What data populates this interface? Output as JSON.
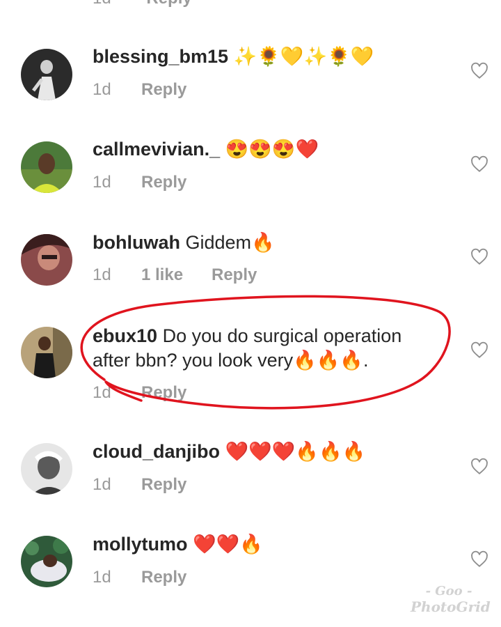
{
  "partial_top": {
    "time": "1d",
    "reply": "Reply"
  },
  "comments": [
    {
      "username": "blessing_bm15",
      "message": "✨🌻💛✨🌻💛",
      "time": "1d",
      "likes": "",
      "reply": "Reply"
    },
    {
      "username": "callmevivian._",
      "message": "😍😍😍❤️",
      "time": "1d",
      "likes": "",
      "reply": "Reply"
    },
    {
      "username": "bohluwah",
      "message": "Giddem🔥",
      "time": "1d",
      "likes": "1 like",
      "reply": "Reply"
    },
    {
      "username": "ebux10",
      "message": "Do you do surgical operation after bbn? you look very🔥🔥🔥.",
      "time": "1d",
      "likes": "",
      "reply": "Reply"
    },
    {
      "username": "cloud_danjibo",
      "message": "❤️❤️❤️🔥🔥🔥",
      "time": "1d",
      "likes": "",
      "reply": "Reply"
    },
    {
      "username": "mollytumo",
      "message": "❤️❤️🔥",
      "time": "1d",
      "likes": "",
      "reply": "Reply"
    }
  ],
  "annotation_color": "#e0141e",
  "watermark": {
    "line1": "- Goo -",
    "line2": "PhotoGrid"
  },
  "icons": {
    "like": "heart-outline-icon"
  }
}
